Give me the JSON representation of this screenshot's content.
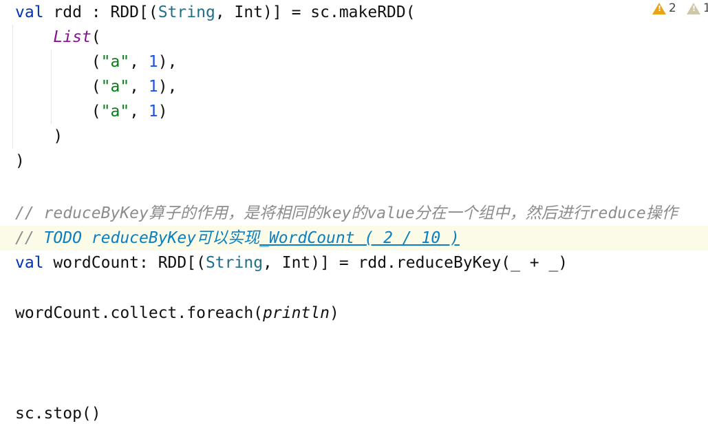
{
  "inspections": {
    "warnings_count": "2",
    "weak_warnings_count": "1"
  },
  "code": {
    "l1": {
      "t1": "val",
      "t2": " rdd : RDD[(",
      "t3": "String",
      "t4": ", Int)] = sc.makeRDD("
    },
    "l2": {
      "t1": "    ",
      "t2": "List",
      "t3": "("
    },
    "l3": {
      "t1": "        (",
      "t2": "\"a\"",
      "t3": ", ",
      "t4": "1",
      "t5": "),"
    },
    "l4": {
      "t1": "        (",
      "t2": "\"a\"",
      "t3": ", ",
      "t4": "1",
      "t5": "),"
    },
    "l5": {
      "t1": "        (",
      "t2": "\"a\"",
      "t3": ", ",
      "t4": "1",
      "t5": ")"
    },
    "l6": {
      "t1": "    )"
    },
    "l7": {
      "t1": ")"
    },
    "l8": {
      "t1": "// reduceByKey算子的作用，是将相同的key的value分在一个组中，然后进行reduce操作"
    },
    "l9": {
      "t1": "// ",
      "t2": "TODO reduceByKey可以实现",
      "t3": "_WordCount ( 2 / 10 )"
    },
    "l10": {
      "t1": "val",
      "t2": " wordCount: RDD[(",
      "t3": "String",
      "t4": ", Int)] = rdd.reduceByKey(_ + _)"
    },
    "l11": {
      "t1": "wordCount.collect.foreach(",
      "t2": "println",
      "t3": ")"
    },
    "l12": {
      "t1": "sc.stop()"
    }
  }
}
